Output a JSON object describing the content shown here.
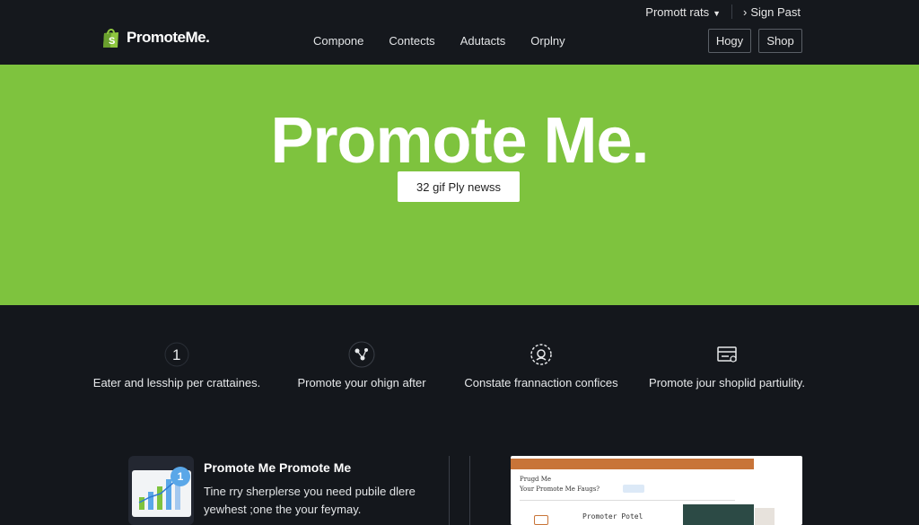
{
  "header": {
    "util": {
      "account_menu": "Promott rats",
      "sign_link": "Sign Past"
    },
    "brand": "PromoteMe.",
    "nav": [
      "Compone",
      "Contects",
      "Adutacts",
      "Orplny"
    ],
    "buttons": {
      "first": "Hogy",
      "second": "Shop"
    }
  },
  "hero": {
    "title": "Promote Me.",
    "badge": "32 gif Ply newss"
  },
  "features": [
    {
      "icon": "number-one-icon",
      "text": "Eater and lesship per crattaines."
    },
    {
      "icon": "share-nodes-icon",
      "text": "Promote your ohign after"
    },
    {
      "icon": "gear-badge-icon",
      "text": "Constate frannaction confices"
    },
    {
      "icon": "store-card-icon",
      "text": "Promote jour shoplid partiulity."
    }
  ],
  "promo": {
    "notif_count": "1",
    "title": "Promote Me Promote Me",
    "desc": "Tine rry sherplerse you need pubile dlere yewhest ;one the your feymay."
  },
  "preview": {
    "line1": "Prugd Me",
    "line2": "Your Promote Me Faugs?",
    "line3": "Promoter Potel"
  },
  "colors": {
    "hero": "#7ec33e",
    "background": "#14171c",
    "brand_green": "#7ec33e",
    "notif": "#5aa7e8"
  }
}
